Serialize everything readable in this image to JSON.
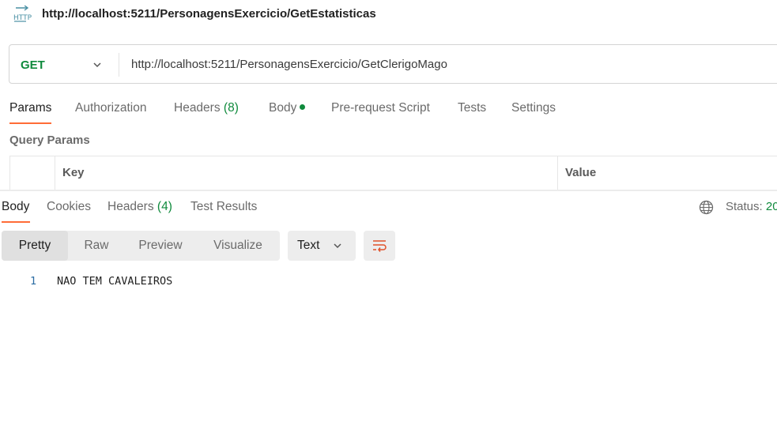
{
  "request": {
    "title": "http://localhost:5211/PersonagensExercicio/GetEstatisticas",
    "method": "GET",
    "url": "http://localhost:5211/PersonagensExercicio/GetClerigoMago",
    "tabs": [
      {
        "label": "Params"
      },
      {
        "label": "Authorization"
      },
      {
        "label": "Headers",
        "count": "(8)"
      },
      {
        "label": "Body"
      },
      {
        "label": "Pre-request Script"
      },
      {
        "label": "Tests"
      },
      {
        "label": "Settings"
      }
    ],
    "query_params_title": "Query Params",
    "table_headers": {
      "key": "Key",
      "value": "Value"
    }
  },
  "response": {
    "tabs": [
      {
        "label": "Body"
      },
      {
        "label": "Cookies"
      },
      {
        "label": "Headers",
        "count": "(4)"
      },
      {
        "label": "Test Results"
      }
    ],
    "status_label": "Status:",
    "status_code": "20",
    "views": [
      "Pretty",
      "Raw",
      "Preview",
      "Visualize"
    ],
    "format": "Text",
    "lines": [
      {
        "n": "1",
        "text": "NAO TEM CAVALEIROS"
      }
    ]
  },
  "colors": {
    "accent": "#ff6c37",
    "success": "#0f8a3c",
    "line_number": "#2b6ca3"
  },
  "icons": [
    "http-icon",
    "chevron-down-icon",
    "globe-icon",
    "wrap-lines-icon"
  ]
}
